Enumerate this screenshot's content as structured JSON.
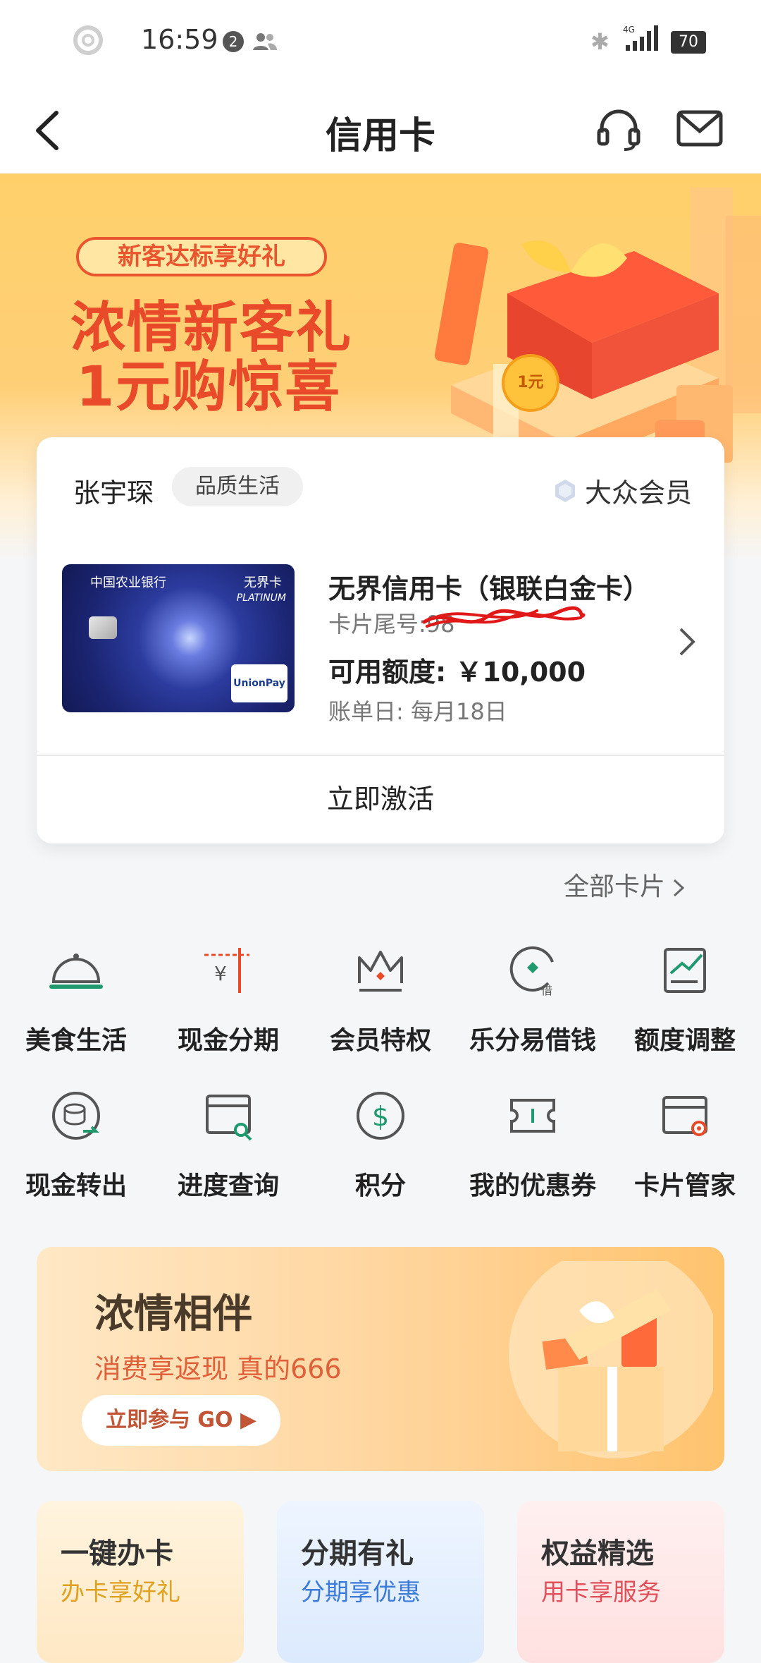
{
  "status_bar": {
    "time": "16:59",
    "notification_count": "2",
    "network": "4G",
    "battery": "70"
  },
  "header": {
    "title": "信用卡"
  },
  "hero_banner": {
    "tag": "新客达标享好礼",
    "line1": "浓情新客礼",
    "line2": "1元购惊喜",
    "coin_text": "1元"
  },
  "card_panel": {
    "holder_name": "张宇琛",
    "lifestyle_tag": "品质生活",
    "membership": "大众会员",
    "card": {
      "image_bank_name": "中国农业银行",
      "image_card_brand": "无界卡",
      "image_tier": "PLATINUM",
      "image_network": "UnionPay 银联",
      "name": "无界信用卡（银联白金卡）",
      "tail_label": "卡片尾号:98",
      "available_limit": "可用额度: ￥10,000",
      "billing_day": "账单日: 每月18日"
    },
    "activate_label": "立即激活"
  },
  "all_cards_label": "全部卡片",
  "services": [
    {
      "label": "美食生活",
      "icon": "cloche-icon"
    },
    {
      "label": "现金分期",
      "icon": "cash-installment-icon"
    },
    {
      "label": "会员特权",
      "icon": "crown-icon"
    },
    {
      "label": "乐分易借钱",
      "icon": "loan-icon"
    },
    {
      "label": "额度调整",
      "icon": "limit-adjust-icon"
    },
    {
      "label": "现金转出",
      "icon": "cash-transfer-icon"
    },
    {
      "label": "进度查询",
      "icon": "progress-search-icon"
    },
    {
      "label": "积分",
      "icon": "points-icon"
    },
    {
      "label": "我的优惠券",
      "icon": "coupon-icon"
    },
    {
      "label": "卡片管家",
      "icon": "card-manager-icon"
    }
  ],
  "promo_banner": {
    "title": "浓情相伴",
    "subtitle": "消费享返现 真的666",
    "button_label": "立即参与 GO ▶"
  },
  "tiles": [
    {
      "title": "一键办卡",
      "subtitle": "办卡享好礼"
    },
    {
      "title": "分期有礼",
      "subtitle": "分期享优惠"
    },
    {
      "title": "权益精选",
      "subtitle": "用卡享服务"
    }
  ],
  "colors": {
    "accent_green": "#1f9a6e",
    "brand_red": "#e84a2a",
    "accent_orange": "#e0603a"
  }
}
